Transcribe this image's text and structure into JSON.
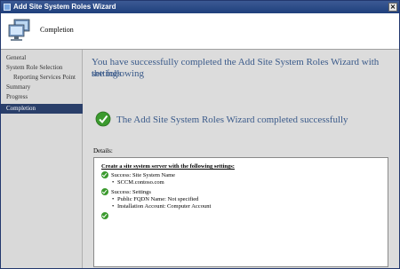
{
  "window": {
    "title": "Add Site System Roles Wizard",
    "close_glyph": "×"
  },
  "header": {
    "title": "Completion",
    "icon": "computer-monitors-icon"
  },
  "sidebar": {
    "items": [
      {
        "label": "General"
      },
      {
        "label": "System Role Selection"
      },
      {
        "label": "Reporting Services Point"
      },
      {
        "label": "Summary"
      },
      {
        "label": "Progress"
      },
      {
        "label": "Completion"
      }
    ]
  },
  "main": {
    "heading_line1": "You have successfully completed the Add Site System Roles Wizard with the following",
    "heading_line2": "settings",
    "success_text": "The Add Site System Roles Wizard completed successfully",
    "details_label": "Details:",
    "details": {
      "header": "Create a site system server with the following settings:",
      "groups": [
        {
          "title": "Success: Site System Name",
          "items": [
            "SCCM.contoso.com"
          ]
        },
        {
          "title": "Success: Settings",
          "items": [
            "Public FQDN Name: Not specified",
            "Installation Account: Computer Account"
          ]
        }
      ]
    }
  },
  "colors": {
    "titlebar": "#1f3f7c",
    "selected_nav": "#2a3f6a",
    "heading_text": "#3a5a8a",
    "success_green": "#3b9a2e"
  }
}
